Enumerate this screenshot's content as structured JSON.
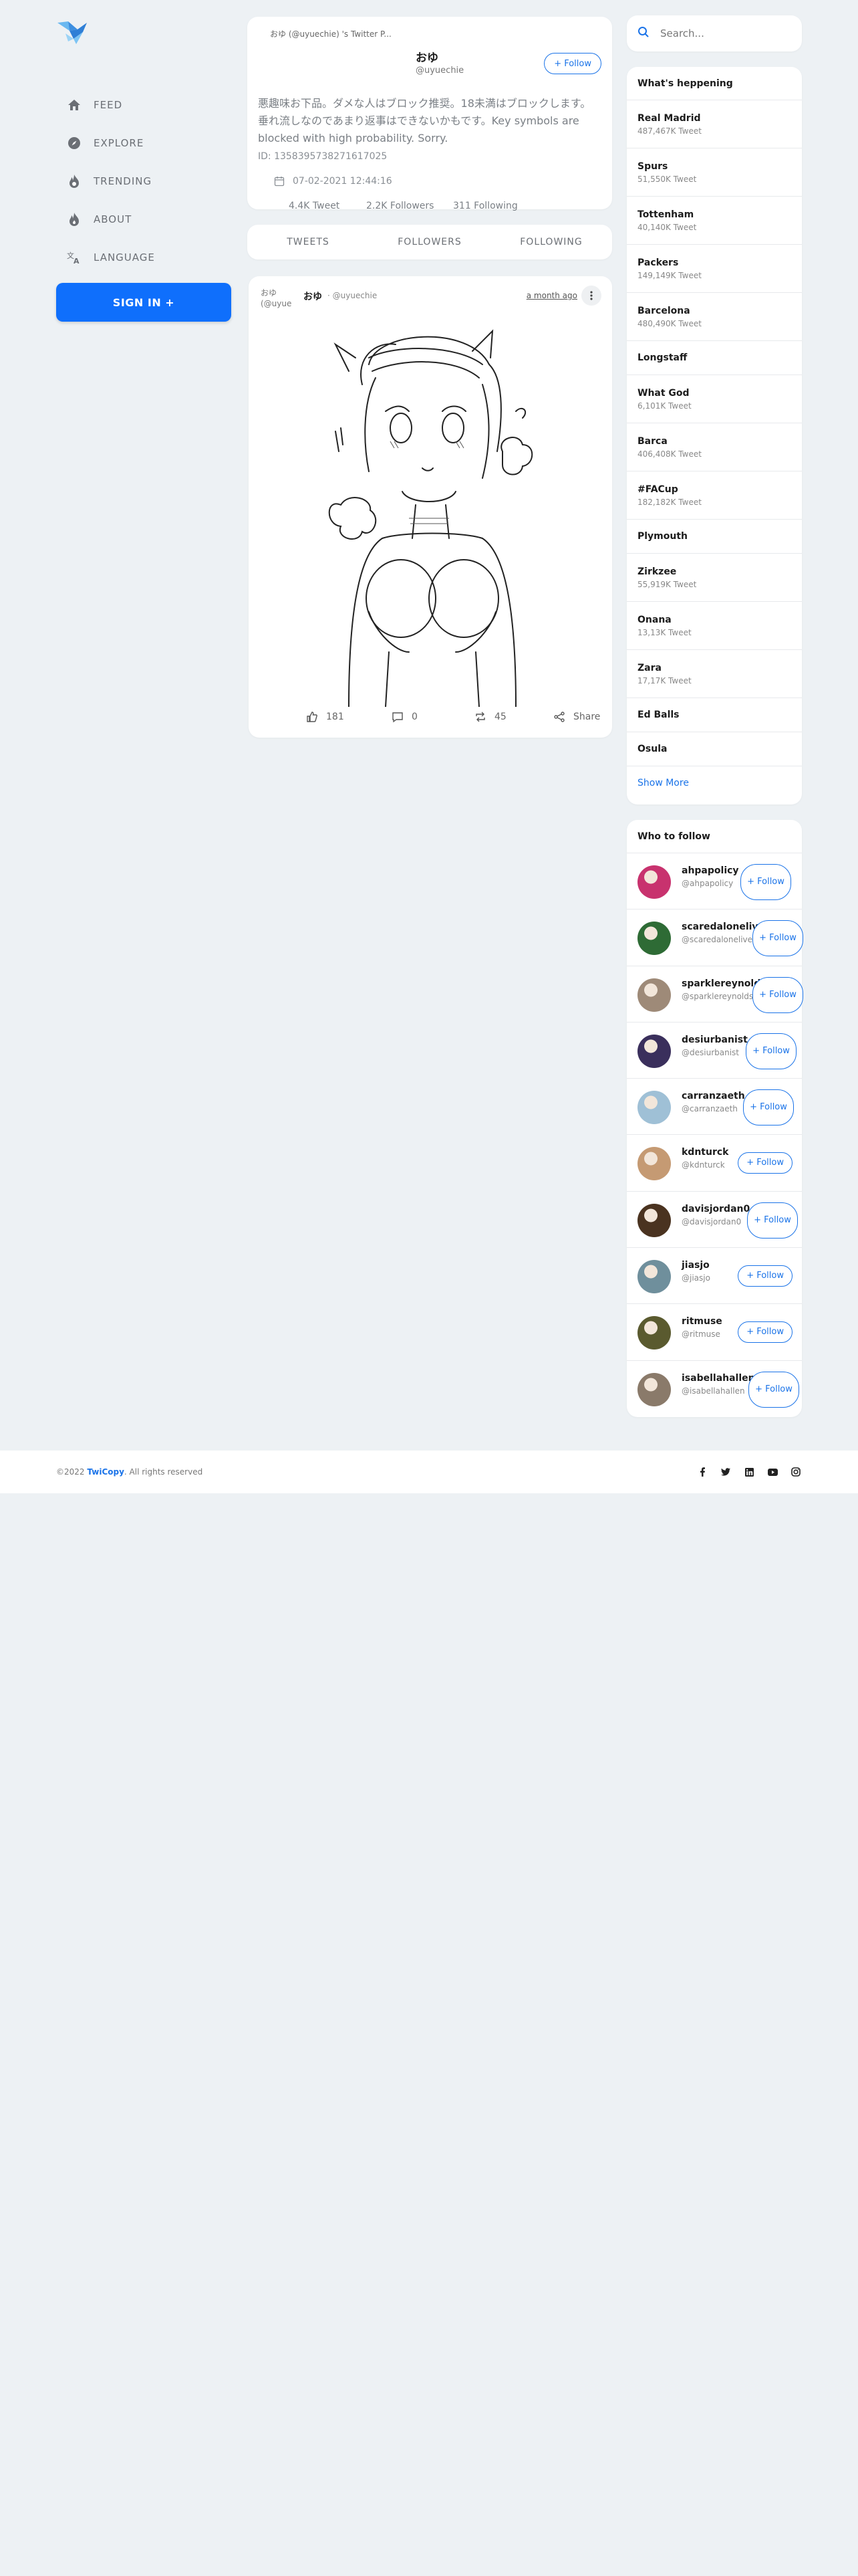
{
  "nav": {
    "items": [
      {
        "label": "FEED",
        "icon": "home-icon"
      },
      {
        "label": "EXPLORE",
        "icon": "compass-icon"
      },
      {
        "label": "TRENDING",
        "icon": "fire-icon"
      },
      {
        "label": "ABOUT",
        "icon": "flame-icon"
      },
      {
        "label": "LANGUAGE",
        "icon": "translate-icon"
      }
    ],
    "signin": "SIGN IN +"
  },
  "profile": {
    "banner_alt": "おゆ (@uyuechie) 's Twitter P...",
    "name": "おゆ",
    "handle": "@uyuechie",
    "follow": "+ Follow",
    "bio": "悪趣味お下品。ダメな人はブロック推奨。18未満はブロックします。 垂れ流しなのであまり返事はできないかもです。Key symbols are blocked with high probability. Sorry.",
    "id": "ID:  1358395738271617025",
    "joined": "07-02-2021 12:44:16",
    "tweets": "4.4K Tweet",
    "followers": "2.2K Followers",
    "following": "311 Following"
  },
  "tabs": [
    "TWEETS",
    "FOLLOWERS",
    "FOLLOWING"
  ],
  "tweet": {
    "avatar_alt": "おゆ (@uyue",
    "name": "おゆ",
    "handle": "· @uyuechie",
    "time": "a month ago",
    "likes": "181",
    "comments": "0",
    "retweets": "45",
    "share": "Share"
  },
  "search": {
    "placeholder": "Search..."
  },
  "trends": {
    "title": "What's heppening",
    "items": [
      {
        "name": "Real Madrid",
        "count": "487,467K Tweet"
      },
      {
        "name": "Spurs",
        "count": "51,550K Tweet"
      },
      {
        "name": "Tottenham",
        "count": "40,140K Tweet"
      },
      {
        "name": "Packers",
        "count": "149,149K Tweet"
      },
      {
        "name": "Barcelona",
        "count": "480,490K Tweet"
      },
      {
        "name": "Longstaff",
        "count": ""
      },
      {
        "name": "What God",
        "count": "6,101K Tweet"
      },
      {
        "name": "Barca",
        "count": "406,408K Tweet"
      },
      {
        "name": "#FACup",
        "count": "182,182K Tweet"
      },
      {
        "name": "Plymouth",
        "count": ""
      },
      {
        "name": "Zirkzee",
        "count": "55,919K Tweet"
      },
      {
        "name": "Onana",
        "count": "13,13K Tweet"
      },
      {
        "name": "Zara",
        "count": "17,17K Tweet"
      },
      {
        "name": "Ed Balls",
        "count": ""
      },
      {
        "name": "Osula",
        "count": ""
      }
    ],
    "show_more": "Show More"
  },
  "who": {
    "title": "Who to follow",
    "users": [
      {
        "name": "ahpapolicy",
        "handle": "@ahpapolicy",
        "btn": "+ Follow",
        "color": "#c8326e"
      },
      {
        "name": "scaredalonelive",
        "handle": "@scaredalonelive",
        "btn": "+ Follow",
        "color": "#2e6b35"
      },
      {
        "name": "sparklereynolds",
        "handle": "@sparklereynolds",
        "btn": "+ Follow",
        "color": "#9e8a78"
      },
      {
        "name": "desiurbanist",
        "handle": "@desiurbanist",
        "btn": "+ Follow",
        "color": "#3a2f5c"
      },
      {
        "name": "carranzaeth",
        "handle": "@carranzaeth",
        "btn": "+ Follow",
        "color": "#9fc0d6"
      },
      {
        "name": "kdnturck",
        "handle": "@kdnturck",
        "btn": "+ Follow",
        "color": "#c59a73"
      },
      {
        "name": "davisjordan0",
        "handle": "@davisjordan0",
        "btn": "+ Follow",
        "color": "#4a3320"
      },
      {
        "name": "jiasjo",
        "handle": "@jiasjo",
        "btn": "+ Follow",
        "color": "#6f8f9c"
      },
      {
        "name": "ritmuse",
        "handle": "@ritmuse",
        "btn": "+ Follow",
        "color": "#5a5a2f"
      },
      {
        "name": "isabellahallen",
        "handle": "@isabellahallen",
        "btn": "+ Follow",
        "color": "#8a7a6a"
      }
    ]
  },
  "footer": {
    "copy_pre": "©2022",
    "brand": "TwiCopy",
    "copy_post": ". All rights reserved"
  }
}
